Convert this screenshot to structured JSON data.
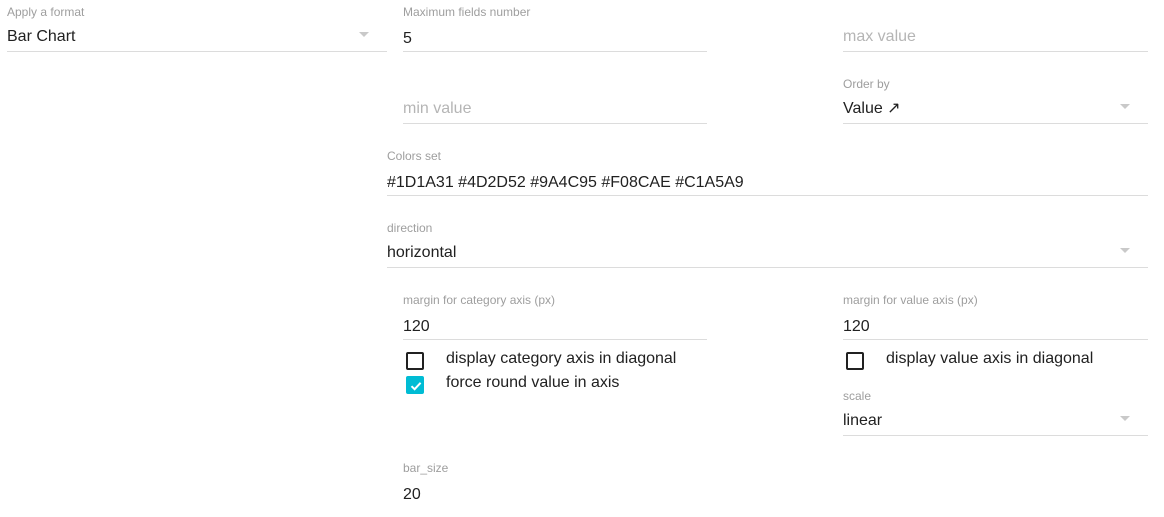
{
  "format": {
    "label": "Apply a format",
    "value": "Bar Chart"
  },
  "max_fields": {
    "label": "Maximum fields number",
    "value": "5"
  },
  "max_value": {
    "placeholder": "max value"
  },
  "min_value": {
    "placeholder": "min value"
  },
  "order_by": {
    "label": "Order by",
    "value": "Value ↗"
  },
  "colors_set": {
    "label": "Colors set",
    "value": "#1D1A31 #4D2D52 #9A4C95 #F08CAE #C1A5A9"
  },
  "direction": {
    "label": "direction",
    "value": "horizontal"
  },
  "margin_category": {
    "label": "margin for category axis (px)",
    "value": "120"
  },
  "margin_value": {
    "label": "margin for value axis (px)",
    "value": "120"
  },
  "diag_category": {
    "label": "display category axis in diagonal",
    "checked": false
  },
  "force_round": {
    "label": "force round value in axis",
    "checked": true
  },
  "diag_value": {
    "label": "display value axis in diagonal",
    "checked": false
  },
  "scale": {
    "label": "scale",
    "value": "linear"
  },
  "bar_size": {
    "label": "bar_size",
    "value": "20"
  },
  "colors": {
    "accent": "#00bcd4",
    "underline": "#dcdcdc",
    "label": "#9e9e9e"
  }
}
